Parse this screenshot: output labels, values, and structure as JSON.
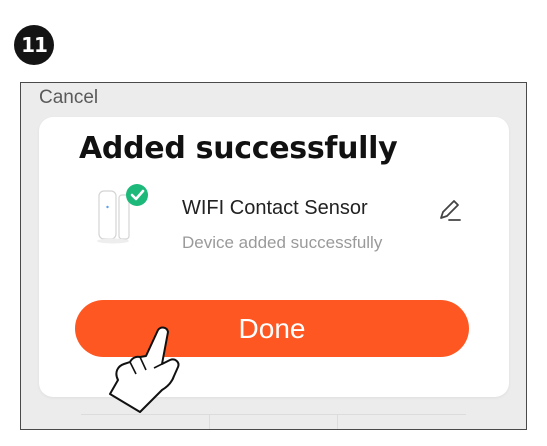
{
  "step_badge": {
    "number": "11"
  },
  "header": {
    "cancel_label": "Cancel"
  },
  "card": {
    "title": "Added successfully",
    "device": {
      "name": "WIFI Contact Sensor",
      "status": "Device added successfully",
      "check_badge_color": "#1db97a"
    },
    "done_label": "Done",
    "accent_color": "#ff5722"
  },
  "icons": {
    "step": "step-number-badge",
    "device": "contact-sensor-icon",
    "check": "check-badge-icon",
    "edit": "pencil-icon",
    "pointer": "hand-pointer-icon"
  }
}
